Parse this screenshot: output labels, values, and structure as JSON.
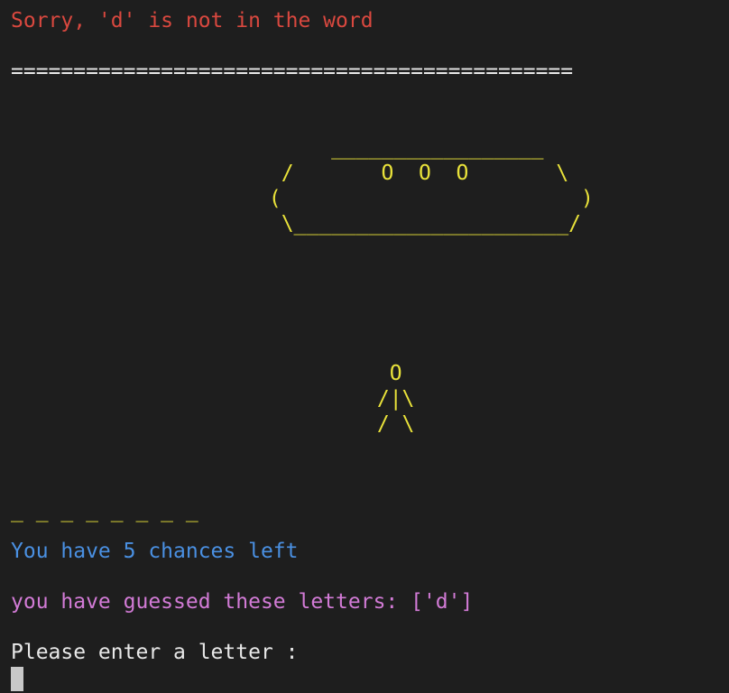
{
  "terminal": {
    "error_message": "Sorry, 'd' is not in the word",
    "separator": "=============================================",
    "ufo_art": "      _________________\n  /       O  O  O       \\\n (                        )\n  \\______________________/",
    "person_art": "  O\n /|\\\n / \\",
    "word_blanks": "_ _ _ _ _ _ _ _",
    "chances_message": "You have 5 chances left",
    "guessed_message": "you have guessed these letters: ['d']",
    "prompt": "Please enter a letter :"
  },
  "colors": {
    "background": "#1e1e1e",
    "error": "#d9483f",
    "art": "#e9e23a",
    "chances": "#4a90e2",
    "guessed": "#d27bd6",
    "prompt": "#e8e8e8"
  }
}
